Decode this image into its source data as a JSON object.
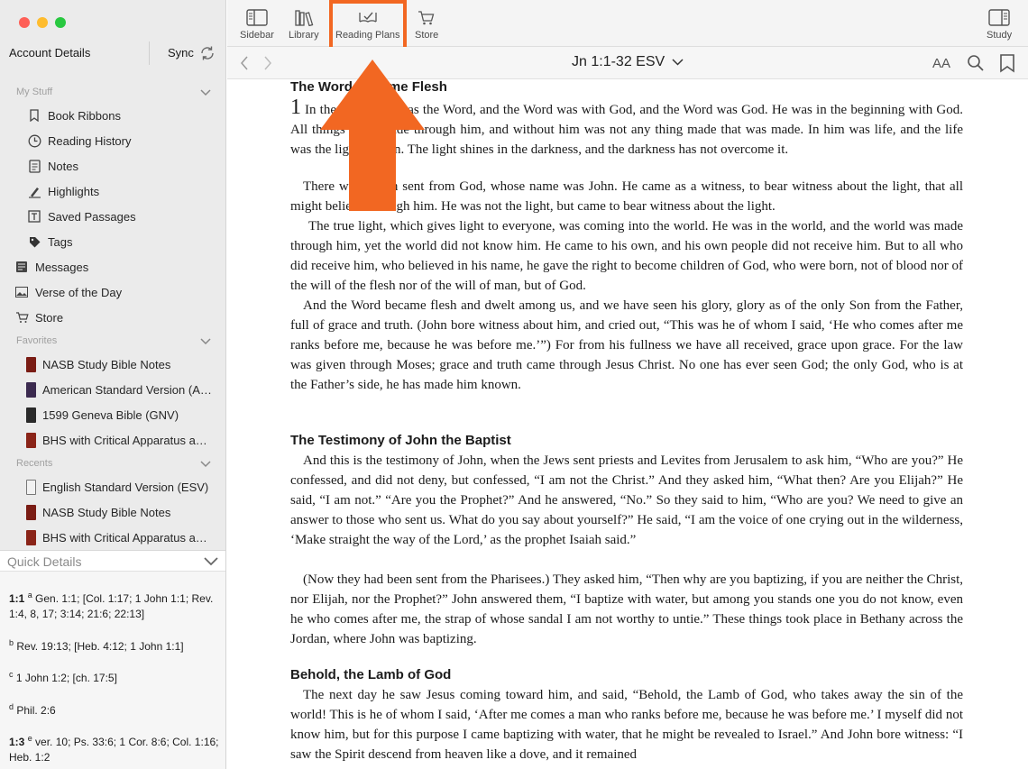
{
  "sidebar": {
    "account_label": "Account Details",
    "sync_label": "Sync",
    "my_stuff": {
      "header": "My Stuff",
      "items": [
        {
          "label": "Book Ribbons"
        },
        {
          "label": "Reading History"
        },
        {
          "label": "Notes"
        },
        {
          "label": "Highlights"
        },
        {
          "label": "Saved Passages"
        },
        {
          "label": "Tags"
        }
      ]
    },
    "top_items": [
      {
        "label": "Messages"
      },
      {
        "label": "Verse of the Day"
      },
      {
        "label": "Store"
      }
    ],
    "favorites": {
      "header": "Favorites",
      "items": [
        {
          "label": "NASB Study Bible Notes",
          "color": "#7a1c14"
        },
        {
          "label": "American Standard Version (A…",
          "color": "#3b2a4f"
        },
        {
          "label": "1599 Geneva Bible (GNV)",
          "color": "#2a2a2a"
        },
        {
          "label": "BHS with Critical Apparatus a…",
          "color": "#8a2418"
        }
      ]
    },
    "recents": {
      "header": "Recents",
      "items": [
        {
          "label": "English Standard Version (ESV)",
          "color": "#f2f2f2"
        },
        {
          "label": "NASB Study Bible Notes",
          "color": "#7a1c14"
        },
        {
          "label": "BHS with Critical Apparatus a…",
          "color": "#8a2418"
        }
      ]
    },
    "quick_details": {
      "label": "Quick Details",
      "notes": [
        {
          "ref": "1:1",
          "letter": "a",
          "text": "Gen. 1:1; [Col. 1:17; 1 John 1:1; Rev. 1:4, 8, 17; 3:14; 21:6; 22:13]"
        },
        {
          "ref": "",
          "letter": "b",
          "text": "Rev. 19:13; [Heb. 4:12; 1 John 1:1]"
        },
        {
          "ref": "",
          "letter": "c",
          "text": "1 John 1:2; [ch. 17:5]"
        },
        {
          "ref": "",
          "letter": "d",
          "text": "Phil. 2:6"
        },
        {
          "ref": "1:3",
          "letter": "e",
          "text": "ver. 10; Ps. 33:6; 1 Cor. 8:6; Col. 1:16; Heb. 1:2"
        }
      ]
    }
  },
  "toolbar": {
    "sidebar_label": "Sidebar",
    "library_label": "Library",
    "reading_plans_label": "Reading Plans",
    "store_label": "Store",
    "study_label": "Study",
    "highlight_color": "#f26722"
  },
  "nav": {
    "reference": "Jn 1:1-32",
    "version": "ESV",
    "text_size_label": "AA"
  },
  "bible": {
    "heading1": "The Word Became Flesh",
    "heading2": "The Testimony of John the Baptist",
    "heading3": "Behold, the Lamb of God",
    "p1_chapter": "1",
    "p1": "In the beginning was the Word, and the Word was with God, and the Word was God. He was in the beginning with God. All things were made through him, and without him was not any thing made that was made. In him was life, and the life was the light of men. The light shines in the darkness, and the darkness has not overcome it.",
    "p2": "There was a man sent from God, whose name was John. He came as a witness, to bear witness about the light, that all might believe through him. He was not the light, but came to bear witness about the light.",
    "p3": "The true light, which gives light to everyone, was coming into the world. He was in the world, and the world was made through him, yet the world did not know him. He came to his own, and his own people did not receive him. But to all who did receive him, who believed in his name, he gave the right to become children of God, who were born, not of blood nor of the will of the flesh nor of the will of man, but of God.",
    "p4": "And the Word became flesh and dwelt among us, and we have seen his glory, glory as of the only Son from the Father, full of grace and truth. (John bore witness about him, and cried out, “This was he of whom I said, ‘He who comes after me ranks before me, because he was before me.’”) For from his fullness we have all received, grace upon grace. For the law was given through Moses; grace and truth came through Jesus Christ. No one has ever seen God; the only God, who is at the Father’s side, he has made him known.",
    "p5": "And this is the testimony of John, when the Jews sent priests and Levites from Jerusalem to ask him, “Who are you?” He confessed, and did not deny, but confessed, “I am not the Christ.” And they asked him, “What then? Are you Elijah?” He said, “I am not.” “Are you the Prophet?” And he answered, “No.” So they said to him, “Who are you? We need to give an answer to those who sent us. What do you say about yourself?” He said, “I am the voice of one crying out in the wilderness, ‘Make straight the way of the Lord,’ as the prophet Isaiah said.”",
    "p6": "(Now they had been sent from the Pharisees.) They asked him, “Then why are you baptizing, if you are neither the Christ, nor Elijah, nor the Prophet?” John answered them, “I baptize with water, but among you stands one you do not know, even he who comes after me, the strap of whose sandal I am not worthy to untie.” These things took place in Bethany across the Jordan, where John was baptizing.",
    "p7": "The next day he saw Jesus coming toward him, and said, “Behold, the Lamb of God, who takes away the sin of the world! This is he of whom I said, ‘After me comes a man who ranks before me, because he was before me.’ I myself did not know him, but for this purpose I came baptizing with water, that he might be revealed to Israel.” And John bore witness: “I saw the Spirit descend from heaven like a dove, and it remained"
  }
}
